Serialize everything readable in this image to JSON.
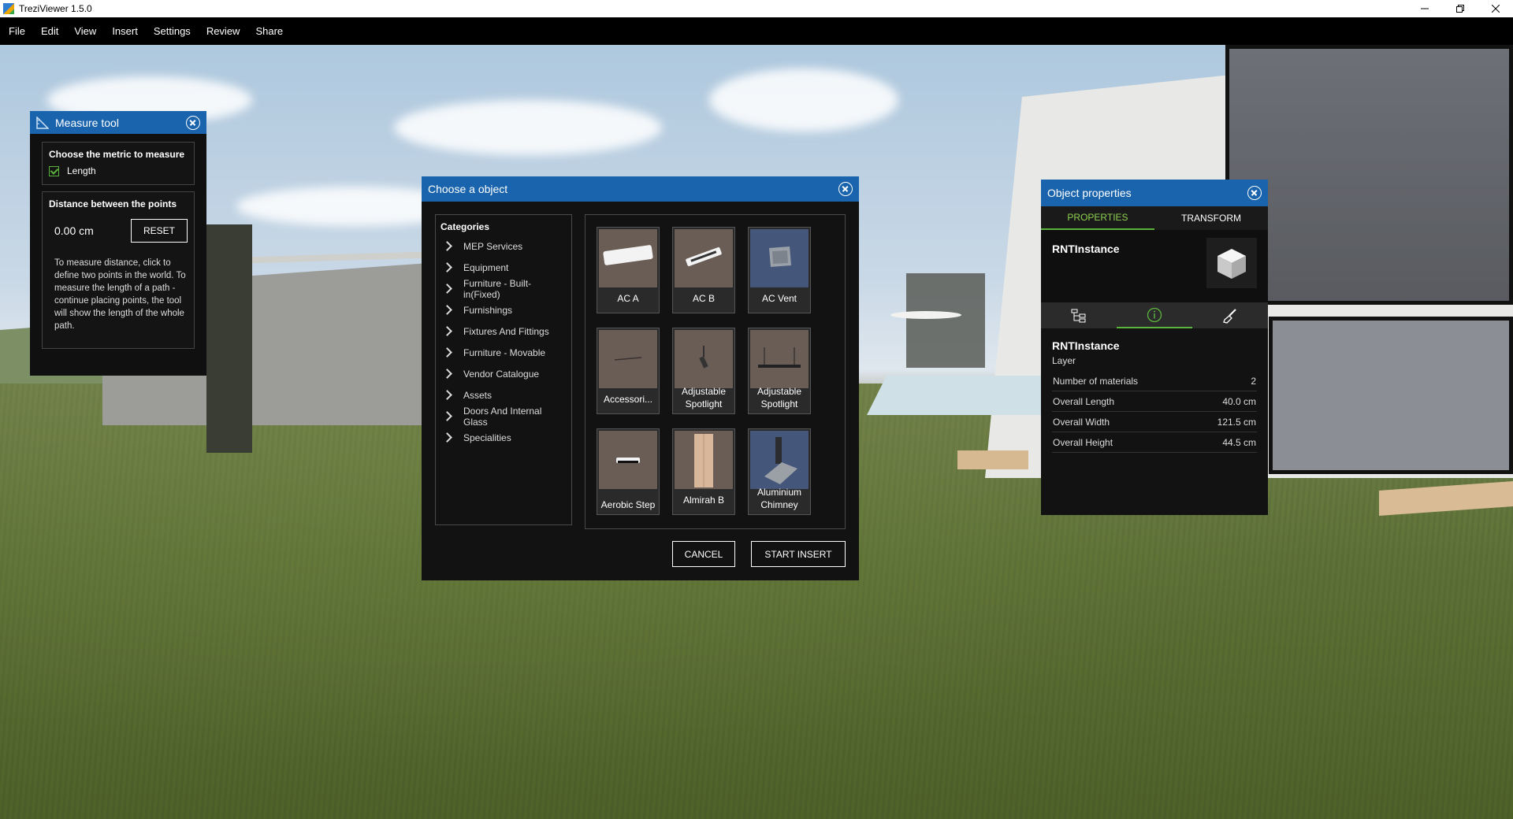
{
  "window": {
    "title": "TreziViewer 1.5.0"
  },
  "menu": [
    "File",
    "Edit",
    "View",
    "Insert",
    "Settings",
    "Review",
    "Share"
  ],
  "measure_tool": {
    "title": "Measure tool",
    "metric_label": "Choose the metric to measure",
    "metric_option": "Length",
    "metric_checked": true,
    "distance_label": "Distance between the points",
    "distance_value": "0.00 cm",
    "reset_label": "RESET",
    "help_text": "To measure distance, click to define two points in the world. To measure the length of a path - continue placing points, the tool will show the length of the whole path."
  },
  "chooser": {
    "title": "Choose a object",
    "categories_title": "Categories",
    "categories": [
      "MEP Services",
      "Equipment",
      "Furniture - Built-in(Fixed)",
      "Furnishings",
      "Fixtures And Fittings",
      "Furniture - Movable",
      "Vendor Catalogue",
      "Assets",
      "Doors And Internal Glass",
      "Specialities"
    ],
    "objects": [
      {
        "name": "AC A",
        "icon": "ac-unit-icon"
      },
      {
        "name": "AC B",
        "icon": "ac-unit-icon"
      },
      {
        "name": "AC Vent",
        "icon": "vent-icon"
      },
      {
        "name": "Accessori...",
        "icon": "accessory-icon"
      },
      {
        "name": "Adjustable Spotlight",
        "icon": "spotlight-icon"
      },
      {
        "name": "Adjustable Spotlight",
        "icon": "spotlight-bar-icon"
      },
      {
        "name": "Aerobic Step",
        "icon": "step-icon"
      },
      {
        "name": "Almirah B",
        "icon": "wardrobe-icon"
      },
      {
        "name": "Aluminium Chimney",
        "icon": "chimney-icon"
      }
    ],
    "cancel_label": "CANCEL",
    "insert_label": "START INSERT"
  },
  "properties": {
    "title": "Object properties",
    "tabs": [
      "PROPERTIES",
      "TRANSFORM"
    ],
    "active_tab": "PROPERTIES",
    "object_name": "RNTInstance",
    "section_name": "RNTInstance",
    "section_sub": "Layer",
    "rows": [
      {
        "label": "Number of materials",
        "value": "2"
      },
      {
        "label": "Overall Length",
        "value": "40.0 cm"
      },
      {
        "label": "Overall Width",
        "value": "121.5 cm"
      },
      {
        "label": "Overall Height",
        "value": "44.5 cm"
      }
    ]
  },
  "colors": {
    "accent": "#1a64ad",
    "active_green": "#5bb33e",
    "panel_bg": "#121212"
  }
}
